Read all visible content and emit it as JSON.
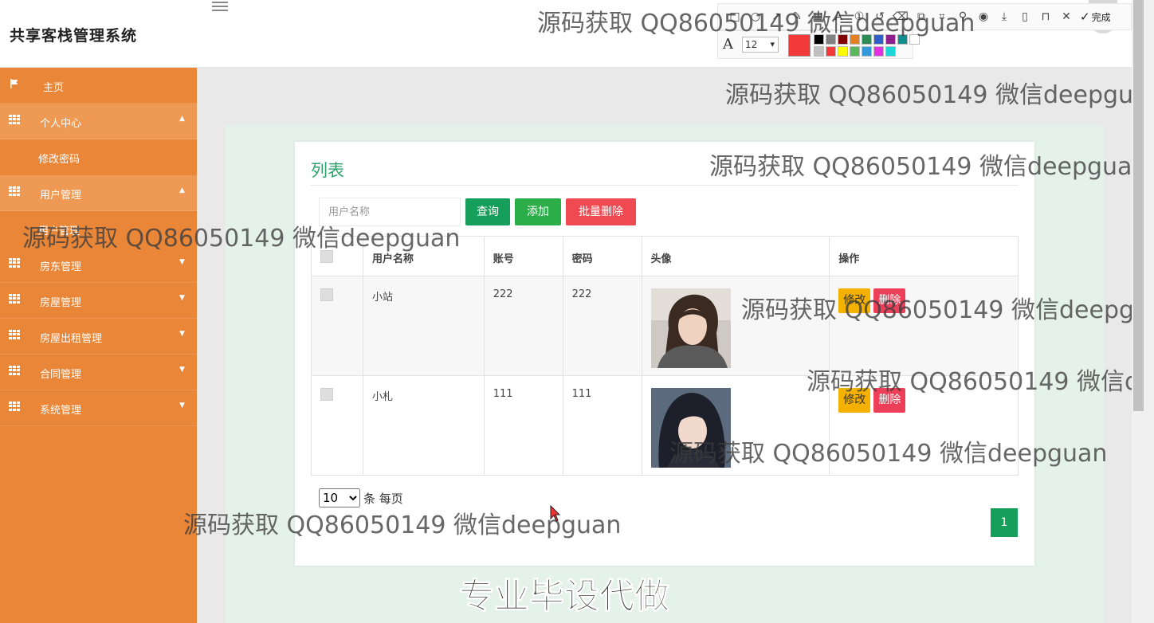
{
  "header": {
    "app_title": "共享客栈管理系统"
  },
  "annotation_toolbar": {
    "tools": [
      "rect-icon",
      "ellipse-icon",
      "arrow-icon",
      "pen-icon",
      "mosaic-icon",
      "text-icon",
      "number-icon",
      "undo-icon",
      "erase-icon",
      "copy-icon",
      "crop-icon",
      "pin-icon",
      "record-icon",
      "download-icon",
      "save-icon",
      "bookmark-icon",
      "close-icon"
    ],
    "done_label": "完成",
    "font_size": "12",
    "current_color": "#f23a3a",
    "palette": [
      "#000000",
      "#808080",
      "#800000",
      "#e67e22",
      "#2e8b57",
      "#2f5fc9",
      "#8e1e8e",
      "#108e8e",
      "#ffffff",
      "#c0c0c0",
      "#f23a3a",
      "#ffff00",
      "#5cb85c",
      "#3498db",
      "#e231e2",
      "#1ad6d6"
    ]
  },
  "sidebar": {
    "items": [
      {
        "label": "主页",
        "icon": "flag-icon",
        "expanded": false
      },
      {
        "label": "个人中心",
        "icon": "grid-icon",
        "expanded": true,
        "sub": [
          "修改密码"
        ]
      },
      {
        "label": "用户管理",
        "icon": "grid-icon",
        "expanded": true,
        "sub": [
          "用户管理"
        ]
      },
      {
        "label": "房东管理",
        "icon": "grid-icon",
        "expanded": false
      },
      {
        "label": "房屋管理",
        "icon": "grid-icon",
        "expanded": false
      },
      {
        "label": "房屋出租管理",
        "icon": "grid-icon",
        "expanded": false
      },
      {
        "label": "合同管理",
        "icon": "grid-icon",
        "expanded": false
      },
      {
        "label": "系统管理",
        "icon": "grid-icon",
        "expanded": false
      }
    ]
  },
  "main": {
    "panel_title": "列表",
    "search_placeholder": "用户名称",
    "buttons": {
      "query": "查询",
      "add": "添加",
      "batch_delete": "批量删除"
    },
    "table": {
      "columns": [
        "用户名称",
        "账号",
        "密码",
        "头像",
        "操作"
      ],
      "rows": [
        {
          "name": "小站",
          "account": "222",
          "password": "222",
          "avatar": "avatar-photo-1"
        },
        {
          "name": "小札",
          "account": "111",
          "password": "111",
          "avatar": "avatar-photo-2"
        }
      ],
      "row_actions": {
        "edit": "修改",
        "delete": "删除"
      }
    },
    "pagination": {
      "per_page_value": "10",
      "per_page_suffix": "条 每页",
      "current_page": "1"
    }
  },
  "watermarks": {
    "text": "源码获取 QQ86050149 微信deepguan",
    "big_text": "专业毕设代做"
  },
  "colors": {
    "sidebar": "#ea8637",
    "accent_green": "#169e5b",
    "title_green": "#2fa36b",
    "danger": "#ef4a52",
    "warning": "#f5b100"
  }
}
